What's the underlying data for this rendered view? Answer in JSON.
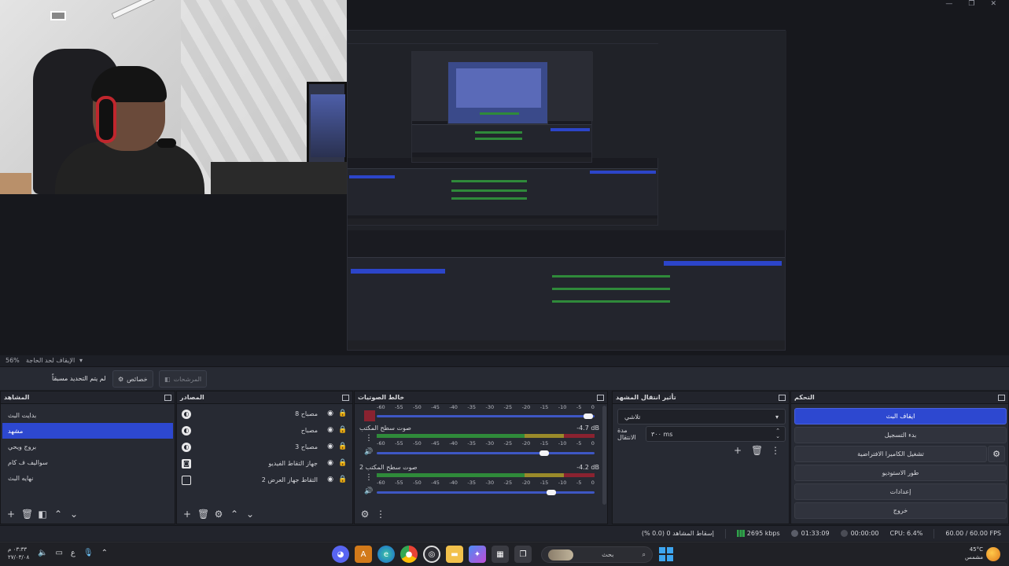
{
  "window": {
    "controls": [
      "—",
      "❐",
      "✕"
    ]
  },
  "preview": {
    "zoom": "56%",
    "zoom_selector": "الإيقاف لحد الحاجة"
  },
  "toolbar": {
    "no_scene_label": "لم يتم التحديد مسبقاً",
    "properties_label": "خصائص",
    "filters_label": "المرشحات"
  },
  "scenes": {
    "title": "المشاهد",
    "items": [
      "بدايت البث",
      "مشهد",
      "بروج ويحي",
      "سواليف ف كام",
      "نهايه البث"
    ],
    "selected_index": 1
  },
  "sources": {
    "title": "المصادر",
    "items": [
      {
        "name": "مصباح 8",
        "icon": "globe-icon"
      },
      {
        "name": "مصباح",
        "icon": "globe-icon"
      },
      {
        "name": "مصباح 3",
        "icon": "globe-icon"
      },
      {
        "name": "جهاز التقاط الفيديو",
        "icon": "camera-icon"
      },
      {
        "name": "التقاط جهاز العرض 2",
        "icon": "monitor-icon"
      }
    ]
  },
  "mixer": {
    "title": "خالط الصوتيات",
    "ticks": [
      "-60",
      "-55",
      "-50",
      "-45",
      "-40",
      "-35",
      "-30",
      "-25",
      "-20",
      "-15",
      "-10",
      "-5",
      "0"
    ],
    "channels": [
      {
        "name": "",
        "db": "",
        "fader": 0.97
      },
      {
        "name": "صوت سطح المكتب",
        "db": "-4.7 dB",
        "fader": 0.77
      },
      {
        "name": "صوت سطح المكتب 2",
        "db": "-4.2 dB",
        "fader": 0.8
      }
    ]
  },
  "transitions": {
    "title": "تأثير انتقال المشهد",
    "selected": "تلاشي",
    "duration_label": "مدة الانتقال",
    "duration_value": "٣٠٠ ms"
  },
  "controls": {
    "title": "التحكم",
    "buttons": [
      "ايقاف البث",
      "بدء التسجيل",
      "تشغيل الكاميرا الافتراضية",
      "طور الاستوديو",
      "إعدادات",
      "خروج"
    ]
  },
  "status": {
    "dropped": "إسقاط المشاهد 0 (0.0 %)",
    "bitrate": "2695 kbps",
    "stream_time": "01:33:09",
    "rec_time": "00:00:00",
    "cpu": "CPU: 6.4%",
    "fps": "60.00 / 60.00 FPS"
  },
  "taskbar": {
    "time": "٠٣:٣٣ م",
    "date": "٢٧/٠٣/٠٨",
    "lang": "ع",
    "search_placeholder": "بحث",
    "weather_temp": "45°C",
    "weather_desc": "مشمس"
  },
  "colors": {
    "accent": "#2d48d0",
    "dock_bg": "#272a33",
    "meter_green": "#2f8a3a",
    "meter_yellow": "#9a8a2a",
    "meter_red": "#8a2230"
  }
}
